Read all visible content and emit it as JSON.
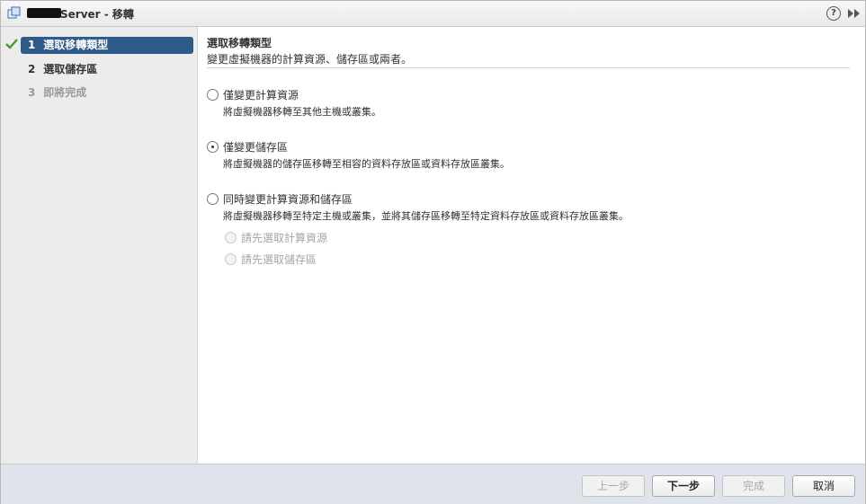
{
  "window": {
    "title": "Server - 移轉",
    "help_symbol": "?",
    "colors": {
      "titlebar": "#e9e9e9",
      "sidebar": "#ececec",
      "footer": "#dee3ec",
      "active_step": "#2f5b8a",
      "check": "#4a9a2e"
    }
  },
  "sidebar": {
    "steps": [
      {
        "number": "1",
        "label": "選取移轉類型",
        "state": "active",
        "completed": true
      },
      {
        "number": "2",
        "label": "選取儲存區",
        "state": "normal"
      },
      {
        "number": "3",
        "label": "即將完成",
        "state": "disabled"
      }
    ]
  },
  "main": {
    "title": "選取移轉類型",
    "subtitle": "變更虛擬機器的計算資源、儲存區或兩者。",
    "options": [
      {
        "label": "僅變更計算資源",
        "description": "將虛擬機器移轉至其他主機或叢集。",
        "selected": false
      },
      {
        "label": "僅變更儲存區",
        "description": "將虛擬機器的儲存區移轉至相容的資料存放區或資料存放區叢集。",
        "selected": true
      },
      {
        "label": "同時變更計算資源和儲存區",
        "description": "將虛擬機器移轉至特定主機或叢集，並將其儲存區移轉至特定資料存放區或資料存放區叢集。",
        "selected": false,
        "suboptions": [
          {
            "label": "請先選取計算資源",
            "enabled": false
          },
          {
            "label": "請先選取儲存區",
            "enabled": false
          }
        ]
      }
    ]
  },
  "footer": {
    "back": "上一步",
    "next": "下一步",
    "finish": "完成",
    "cancel": "取消"
  }
}
